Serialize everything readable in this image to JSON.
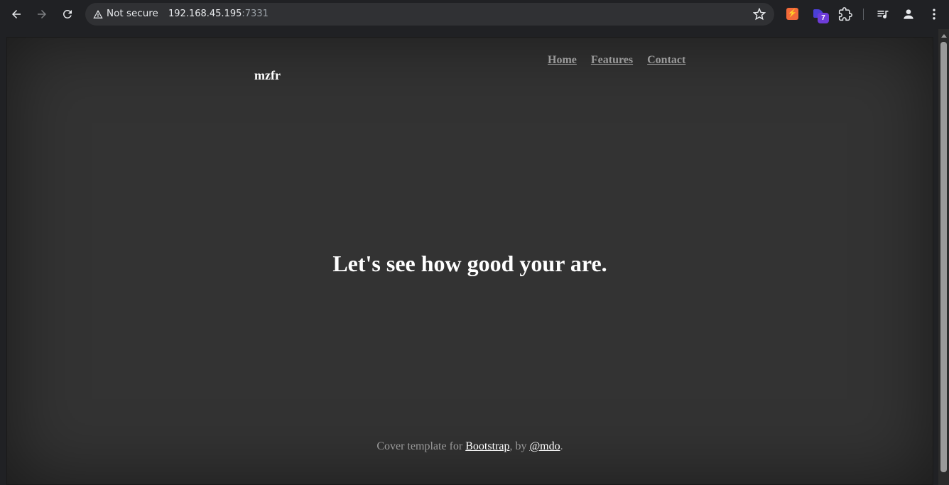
{
  "browser": {
    "security_label": "Not secure",
    "url_host": "192.168.45.195",
    "url_port": ":7331",
    "extension_badge": "7",
    "icons": [
      "back-arrow-icon",
      "forward-arrow-icon",
      "reload-icon",
      "warning-icon",
      "star-icon",
      "extensions-puzzle-icon",
      "media-controls-icon",
      "profile-icon",
      "menu-dots-icon"
    ]
  },
  "site": {
    "brand": "mzfr",
    "nav": {
      "home": "Home",
      "features": "Features",
      "contact": "Contact"
    },
    "headline": "Let's see how good your are.",
    "footer": {
      "prefix": "Cover template for ",
      "bootstrap_link": "Bootstrap",
      "middle": ", by ",
      "author_link": "@mdo",
      "suffix": "."
    }
  },
  "colors": {
    "page_bg": "#333333",
    "chrome_bg": "#202124",
    "nav_link": "#9a9a9a",
    "text": "#ffffff"
  }
}
